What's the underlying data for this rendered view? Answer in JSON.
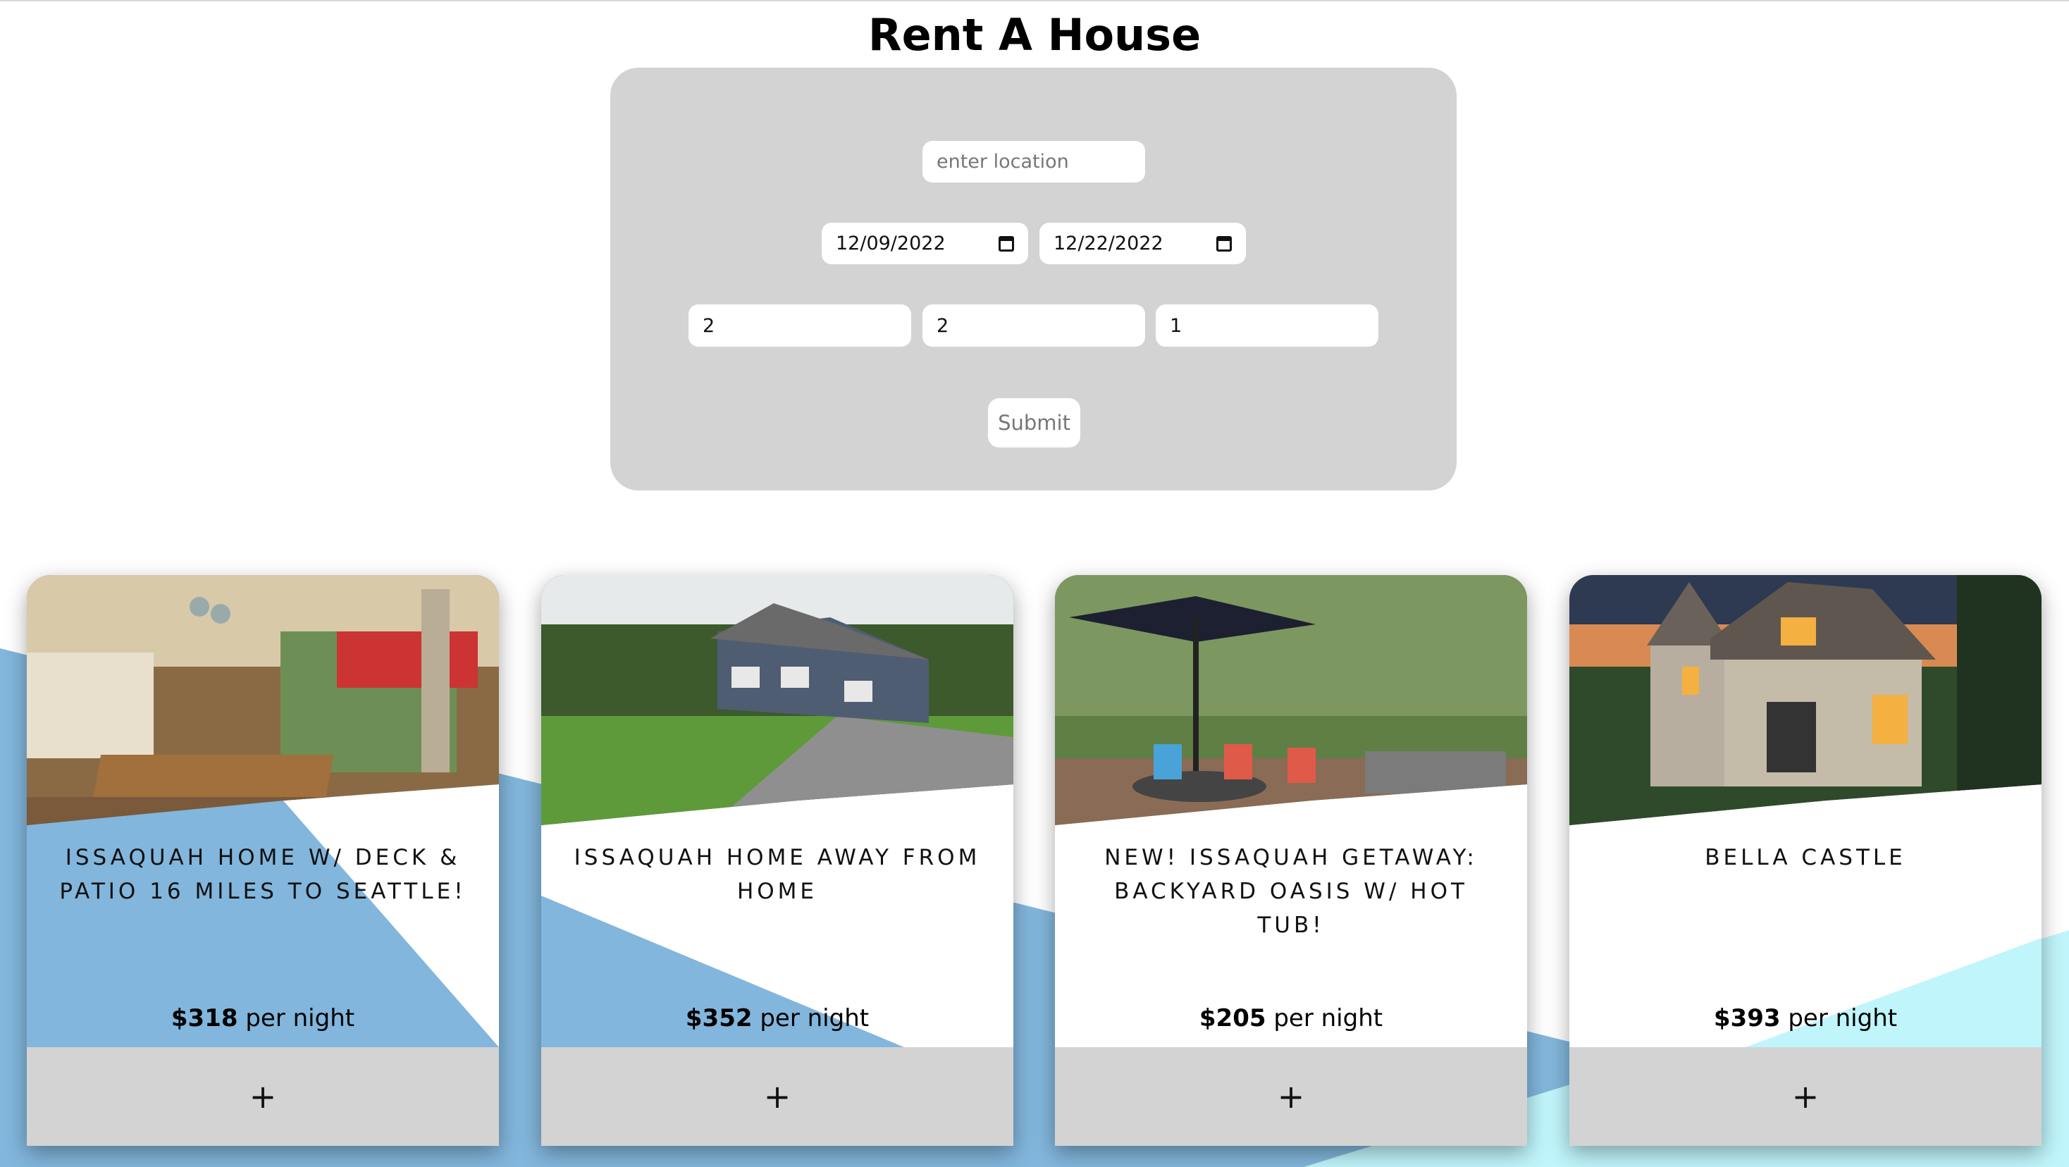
{
  "page": {
    "title": "Rent A House"
  },
  "search": {
    "location_placeholder": "enter location",
    "checkin": "12/09/2022",
    "checkout": "12/22/2022",
    "count_1": "2",
    "count_2": "2",
    "count_3": "1",
    "submit_label": "Submit"
  },
  "listings": [
    {
      "title": "ISSAQUAH HOME W/ DECK & PATIO 16 MILES TO SEATTLE!",
      "price": "$318",
      "price_suffix": " per night",
      "add_label": "+"
    },
    {
      "title": "ISSAQUAH HOME AWAY FROM HOME",
      "price": "$352",
      "price_suffix": " per night",
      "add_label": "+"
    },
    {
      "title": "NEW! ISSAQUAH GETAWAY: BACKYARD OASIS W/ HOT TUB!",
      "price": "$205",
      "price_suffix": " per night",
      "add_label": "+"
    },
    {
      "title": "BELLA CASTLE",
      "price": "$393",
      "price_suffix": " per night",
      "add_label": "+"
    }
  ],
  "colors": {
    "panel": "#d3d3d3",
    "accent_blue": "#82b6dc",
    "accent_cyan": "#bff5fb",
    "button_bar": "#d3d3d3"
  }
}
